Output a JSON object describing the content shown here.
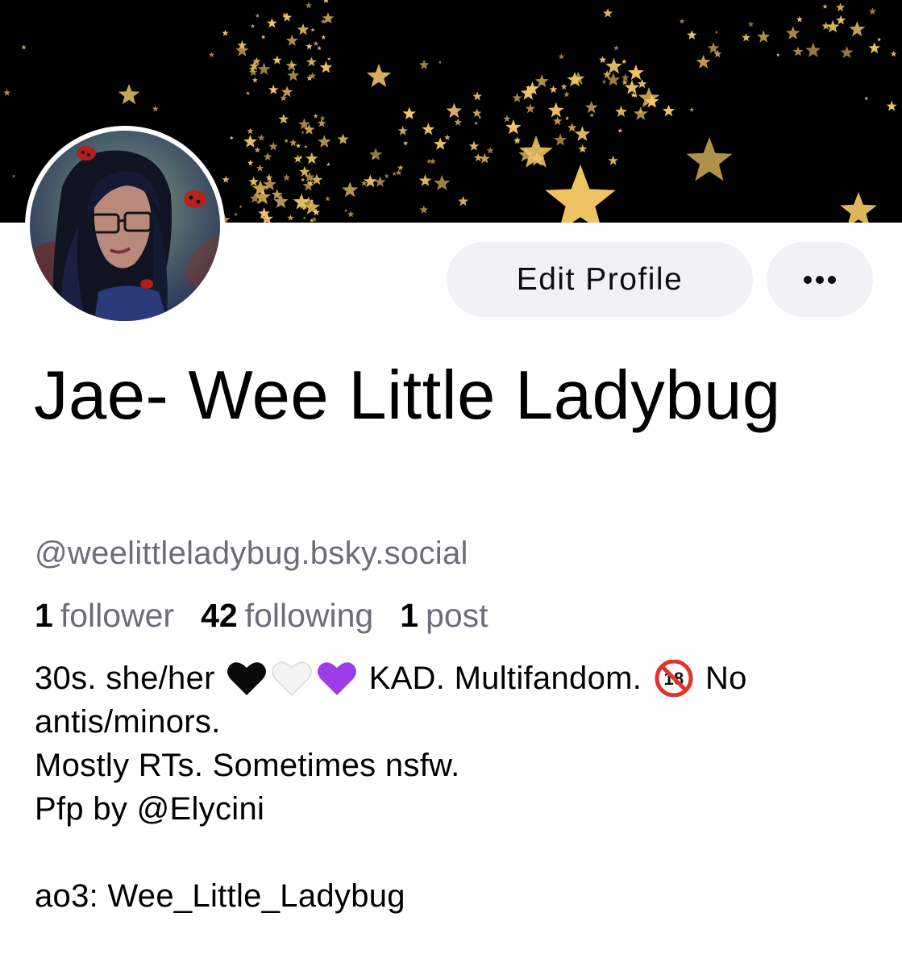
{
  "profile": {
    "display_name": "Jae- Wee Little Ladybug",
    "handle": "@weelittleladybug.bsky.social",
    "edit_label": "Edit Profile",
    "more_icon": "ellipsis-icon",
    "banner_image": "golden-stars-on-black",
    "avatar_image": "illustrated-woman-with-glasses-and-ladybugs"
  },
  "stats": {
    "followers_count": "1",
    "followers_label": "follower",
    "following_count": "42",
    "following_label": "following",
    "posts_count": "1",
    "posts_label": "post"
  },
  "bio": {
    "line1_a": "30s. she/her",
    "emoji_1": "black-heart-icon",
    "emoji_2": "white-heart-icon",
    "emoji_3": "purple-heart-icon",
    "line1_b": "KAD. Multifandom.",
    "emoji_4": "no-one-under-eighteen-icon",
    "line1_c": "No",
    "line2": "antis/minors.",
    "line3": "Mostly RTs. Sometimes nsfw.",
    "line4": "Pfp by @Elycini",
    "line6": "ao3: Wee_Little_Ladybug"
  },
  "colors": {
    "muted_text": "#6a6e78",
    "button_bg": "#f1f2f6",
    "star_gold": "#f3c766"
  }
}
